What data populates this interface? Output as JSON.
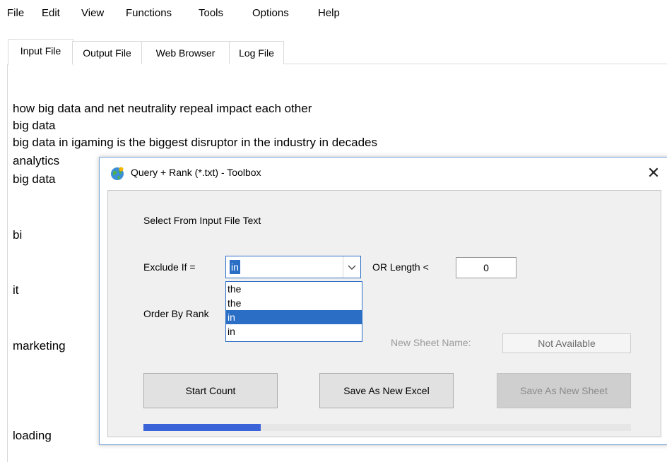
{
  "menu": [
    "File",
    "Edit",
    "View",
    "Functions",
    "Tools",
    "Options",
    "Help"
  ],
  "tabs": [
    "Input File",
    "Output File",
    "Web Browser",
    "Log File"
  ],
  "active_tab": "Input File",
  "lines": [
    "how big data and net neutrality repeal impact each other",
    "big data",
    "big data in igaming is the biggest disruptor in the industry in decades",
    "analytics",
    "big data",
    "bi",
    "it",
    "marketing",
    "loading"
  ],
  "dialog": {
    "title": "Query + Rank (*.txt) - Toolbox",
    "select_label": "Select From Input File Text",
    "exclude_label": "Exclude If =",
    "exclude_value": "in",
    "or_length_label": "OR Length <",
    "length_value": "0",
    "order_by_label": "Order By Rank",
    "dropdown_options": [
      "the",
      "the",
      "in",
      "in"
    ],
    "dropdown_selected_index": 2,
    "new_sheet_label": "New Sheet Name:",
    "new_sheet_value": "Not Available",
    "buttons": {
      "start": "Start Count",
      "save_excel": "Save As New Excel",
      "save_sheet": "Save As New Sheet"
    },
    "progress": 0.24,
    "close": "✕"
  },
  "colors": {
    "accent": "#2b6ec6",
    "progress": "#3b63d9"
  },
  "icons": {
    "app": "globe-icon",
    "combo": "chevron-down-icon",
    "close": "close-icon"
  }
}
